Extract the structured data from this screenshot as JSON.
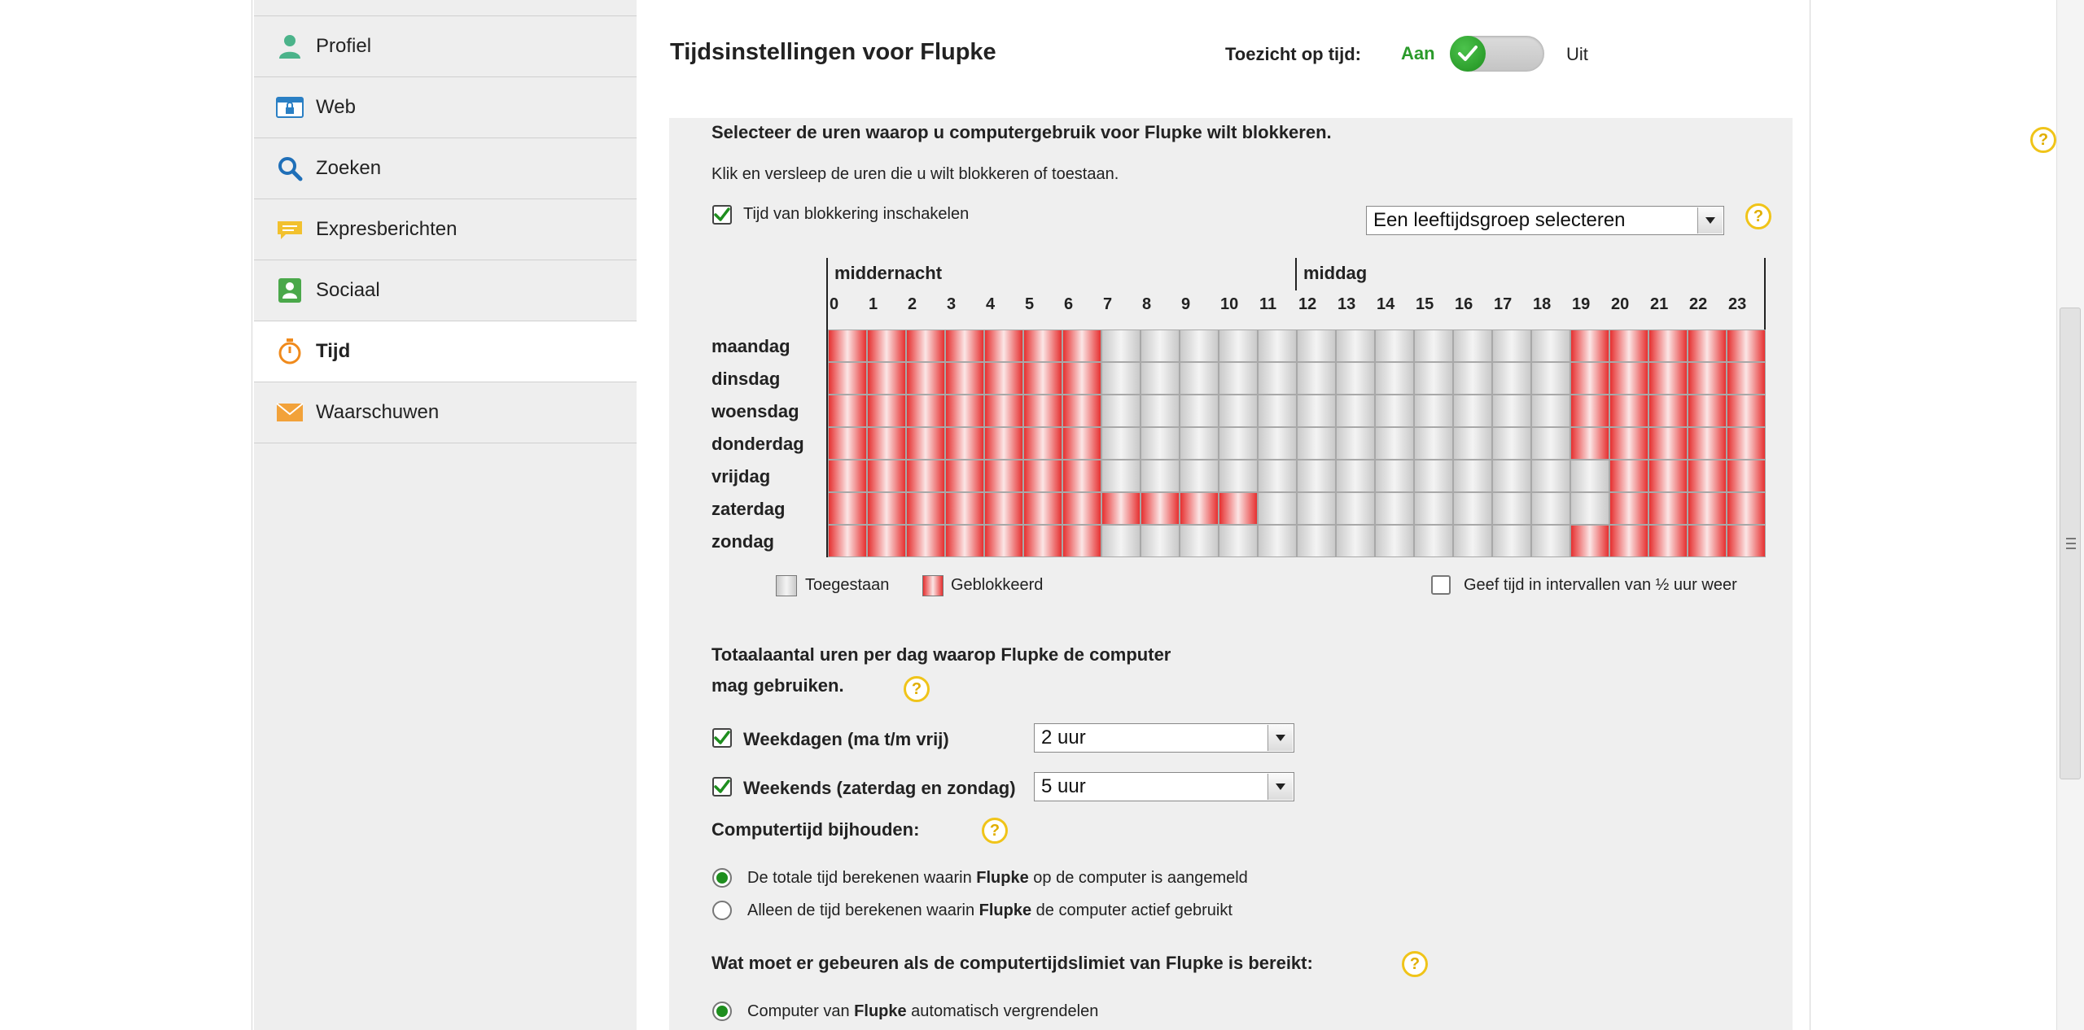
{
  "sidebar": {
    "items": [
      {
        "label": "Profiel",
        "icon": "user-icon"
      },
      {
        "label": "Web",
        "icon": "web-lock-icon"
      },
      {
        "label": "Zoeken",
        "icon": "search-icon"
      },
      {
        "label": "Expresberichten",
        "icon": "chat-icon"
      },
      {
        "label": "Sociaal",
        "icon": "social-icon"
      },
      {
        "label": "Tijd",
        "icon": "stopwatch-icon",
        "active": true
      },
      {
        "label": "Waarschuwen",
        "icon": "mail-icon"
      }
    ]
  },
  "header": {
    "title": "Tijdsinstellingen voor Flupke",
    "supervision_label": "Toezicht op tijd:",
    "on_label": "Aan",
    "off_label": "Uit",
    "supervision_on": true
  },
  "block": {
    "heading": "Selecteer de uren waarop u computergebruik voor Flupke wilt blokkeren.",
    "instruction": "Klik en versleep de uren die u wilt blokkeren of toestaan.",
    "enable_label": "Tijd van blokkering inschakelen",
    "enable_checked": true,
    "age_group_placeholder": "Een leeftijdsgroep selecteren",
    "midnight_label": "middernacht",
    "noon_label": "middag",
    "hours": [
      "0",
      "1",
      "2",
      "3",
      "4",
      "5",
      "6",
      "7",
      "8",
      "9",
      "10",
      "11",
      "12",
      "13",
      "14",
      "15",
      "16",
      "17",
      "18",
      "19",
      "20",
      "21",
      "22",
      "23"
    ],
    "days": [
      {
        "name": "maandag",
        "blocked": [
          0,
          1,
          2,
          3,
          4,
          5,
          6,
          19,
          20,
          21,
          22,
          23
        ]
      },
      {
        "name": "dinsdag",
        "blocked": [
          0,
          1,
          2,
          3,
          4,
          5,
          6,
          19,
          20,
          21,
          22,
          23
        ]
      },
      {
        "name": "woensdag",
        "blocked": [
          0,
          1,
          2,
          3,
          4,
          5,
          6,
          19,
          20,
          21,
          22,
          23
        ]
      },
      {
        "name": "donderdag",
        "blocked": [
          0,
          1,
          2,
          3,
          4,
          5,
          6,
          19,
          20,
          21,
          22,
          23
        ]
      },
      {
        "name": "vrijdag",
        "blocked": [
          0,
          1,
          2,
          3,
          4,
          5,
          6,
          20,
          21,
          22,
          23
        ]
      },
      {
        "name": "zaterdag",
        "blocked": [
          0,
          1,
          2,
          3,
          4,
          5,
          6,
          7,
          8,
          9,
          10,
          20,
          21,
          22,
          23
        ]
      },
      {
        "name": "zondag",
        "blocked": [
          0,
          1,
          2,
          3,
          4,
          5,
          6,
          19,
          20,
          21,
          22,
          23
        ]
      }
    ],
    "legend_allowed": "Toegestaan",
    "legend_blocked": "Geblokkeerd",
    "half_hour_label": "Geef tijd in intervallen van ½ uur weer",
    "half_hour_checked": false
  },
  "totals": {
    "heading_line1": "Totaalaantal uren per dag waarop Flupke de computer",
    "heading_line2": "mag gebruiken.",
    "weekdays_label": "Weekdagen (ma t/m vrij)",
    "weekdays_checked": true,
    "weekdays_value": "2 uur",
    "weekends_label": "Weekends (zaterdag en zondag)",
    "weekends_checked": true,
    "weekends_value": "5 uur"
  },
  "tracking": {
    "heading": "Computertijd bijhouden:",
    "option1_pre": "De totale tijd berekenen waarin ",
    "option1_bold": "Flupke",
    "option1_post": " op de computer is aangemeld",
    "option1_selected": true,
    "option2_pre": "Alleen de tijd berekenen waarin ",
    "option2_bold": "Flupke",
    "option2_post": " de computer actief gebruikt",
    "option2_selected": false
  },
  "limit": {
    "heading": "Wat moet er gebeuren als de computertijdslimiet van Flupke is bereikt:",
    "option1_pre": "Computer van ",
    "option1_bold": "Flupke",
    "option1_post": " automatisch vergrendelen",
    "option1_selected": true
  },
  "colors": {
    "accent_green": "#1e8e1e",
    "blocked_red": "#e63030",
    "help_yellow": "#f0c419"
  }
}
